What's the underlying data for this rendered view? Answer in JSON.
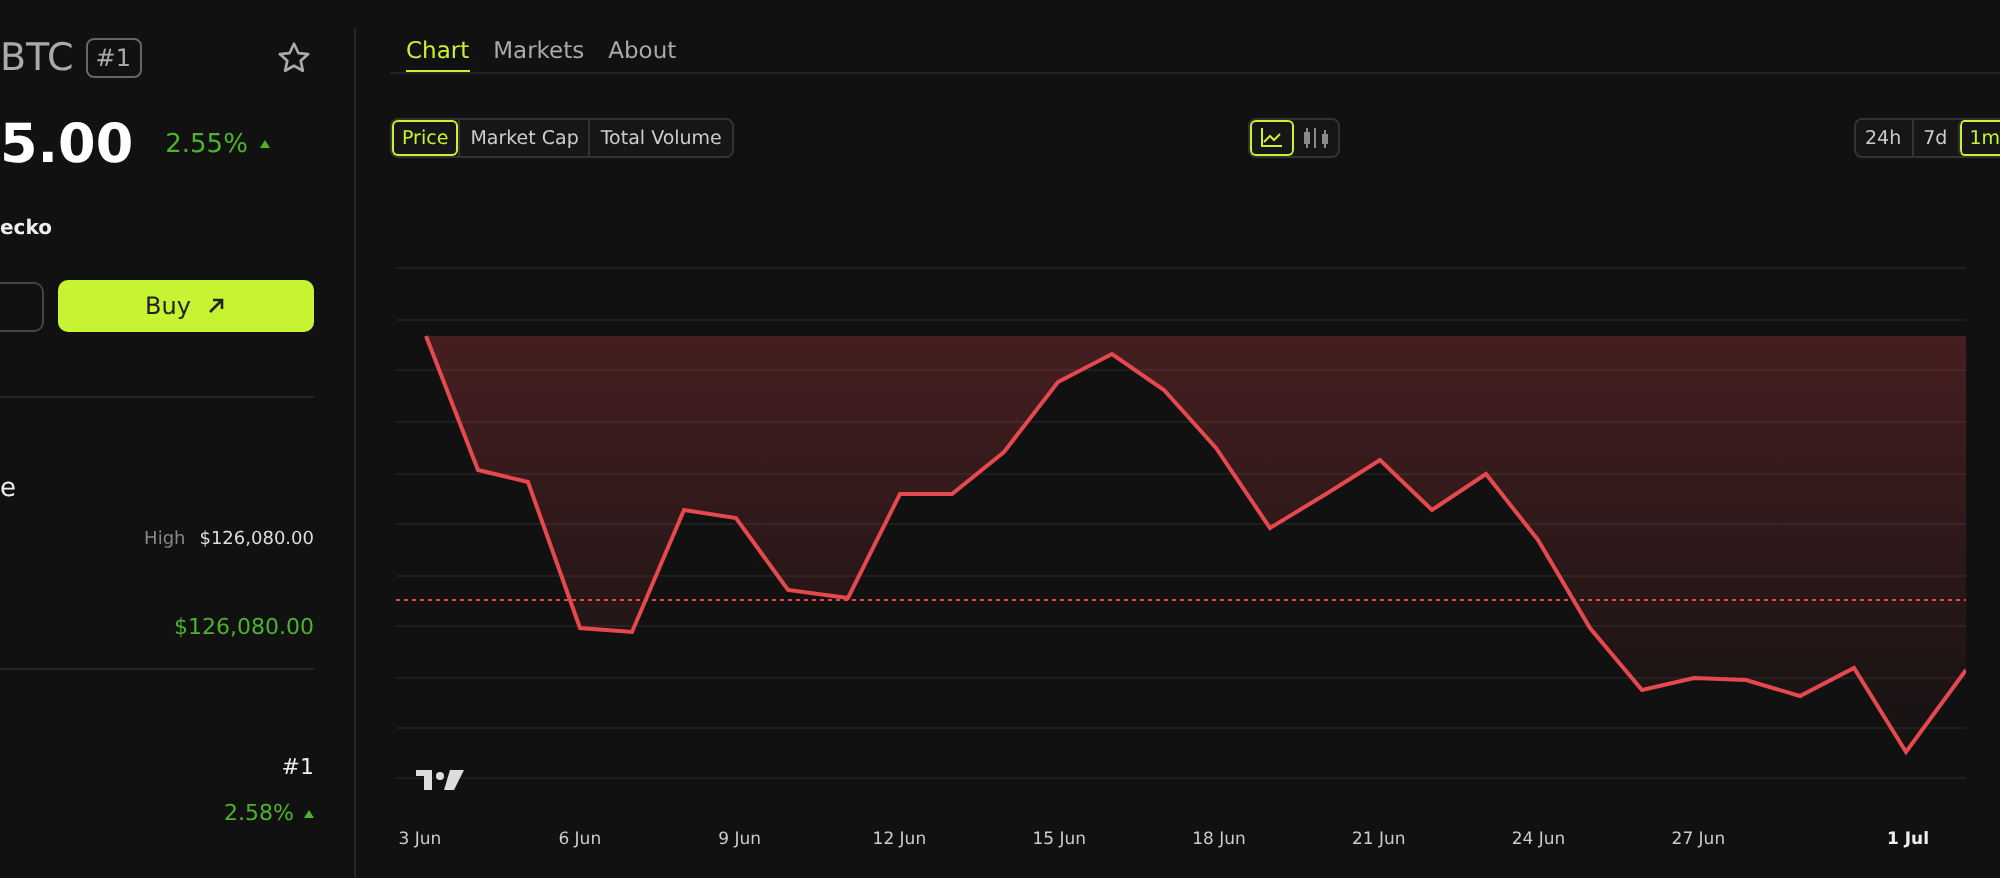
{
  "coin": {
    "symbol": "BTC",
    "rank": "#1",
    "price": "5.00",
    "change": "2.55%",
    "change_up": true,
    "source": "ecko",
    "buy_label": "Buy"
  },
  "stats": [
    {
      "kind": "heading",
      "text": "e"
    },
    {
      "kind": "pair",
      "label": "High",
      "value": "$126,080.00"
    },
    {
      "kind": "green",
      "value": "$126,080.00"
    },
    {
      "kind": "divider"
    },
    {
      "kind": "plain",
      "value": "#1"
    },
    {
      "kind": "change",
      "value": "2.58%",
      "up": true
    }
  ],
  "tabs": [
    {
      "label": "Chart",
      "selected": true
    },
    {
      "label": "Markets",
      "selected": false
    },
    {
      "label": "About",
      "selected": false
    }
  ],
  "metrics": [
    {
      "label": "Price",
      "selected": true
    },
    {
      "label": "Market Cap",
      "selected": false
    },
    {
      "label": "Total Volume",
      "selected": false
    }
  ],
  "chart_types": [
    {
      "kind": "line",
      "selected": true
    },
    {
      "kind": "candles",
      "selected": false
    }
  ],
  "ranges": [
    {
      "label": "24h",
      "selected": false
    },
    {
      "label": "7d",
      "selected": false
    },
    {
      "label": "1m",
      "selected": true
    }
  ],
  "x_labels": [
    {
      "text": "3 Jun",
      "emphasized": false
    },
    {
      "text": "6 Jun",
      "emphasized": false
    },
    {
      "text": "9 Jun",
      "emphasized": false
    },
    {
      "text": "12 Jun",
      "emphasized": false
    },
    {
      "text": "15 Jun",
      "emphasized": false
    },
    {
      "text": "18 Jun",
      "emphasized": false
    },
    {
      "text": "21 Jun",
      "emphasized": false
    },
    {
      "text": "24 Jun",
      "emphasized": false
    },
    {
      "text": "27 Jun",
      "emphasized": false
    },
    {
      "text": "1 Jul",
      "emphasized": true
    }
  ]
}
